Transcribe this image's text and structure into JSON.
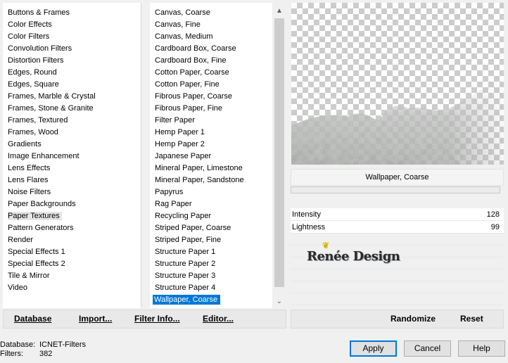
{
  "categories": {
    "items": [
      {
        "label": "Buttons & Frames"
      },
      {
        "label": "Color Effects"
      },
      {
        "label": "Color Filters"
      },
      {
        "label": "Convolution Filters"
      },
      {
        "label": "Distortion Filters"
      },
      {
        "label": "Edges, Round"
      },
      {
        "label": "Edges, Square"
      },
      {
        "label": "Frames, Marble & Crystal"
      },
      {
        "label": "Frames, Stone & Granite"
      },
      {
        "label": "Frames, Textured"
      },
      {
        "label": "Frames, Wood"
      },
      {
        "label": "Gradients"
      },
      {
        "label": "Image Enhancement"
      },
      {
        "label": "Lens Effects"
      },
      {
        "label": "Lens Flares"
      },
      {
        "label": "Noise Filters"
      },
      {
        "label": "Paper Backgrounds"
      },
      {
        "label": "Paper Textures"
      },
      {
        "label": "Pattern Generators"
      },
      {
        "label": "Render"
      },
      {
        "label": "Special Effects 1"
      },
      {
        "label": "Special Effects 2"
      },
      {
        "label": "Tile & Mirror"
      },
      {
        "label": "Video"
      }
    ],
    "selected_index": 17
  },
  "filters": {
    "items": [
      {
        "label": "Canvas, Coarse"
      },
      {
        "label": "Canvas, Fine"
      },
      {
        "label": "Canvas, Medium"
      },
      {
        "label": "Cardboard Box, Coarse"
      },
      {
        "label": "Cardboard Box, Fine"
      },
      {
        "label": "Cotton Paper, Coarse"
      },
      {
        "label": "Cotton Paper, Fine"
      },
      {
        "label": "Fibrous Paper, Coarse"
      },
      {
        "label": "Fibrous Paper, Fine"
      },
      {
        "label": "Filter Paper"
      },
      {
        "label": "Hemp Paper 1"
      },
      {
        "label": "Hemp Paper 2"
      },
      {
        "label": "Japanese Paper"
      },
      {
        "label": "Mineral Paper, Limestone"
      },
      {
        "label": "Mineral Paper, Sandstone"
      },
      {
        "label": "Papyrus"
      },
      {
        "label": "Rag Paper"
      },
      {
        "label": "Recycling Paper"
      },
      {
        "label": "Striped Paper, Coarse"
      },
      {
        "label": "Striped Paper, Fine"
      },
      {
        "label": "Structure Paper 1"
      },
      {
        "label": "Structure Paper 2"
      },
      {
        "label": "Structure Paper 3"
      },
      {
        "label": "Structure Paper 4"
      },
      {
        "label": "Wallpaper, Coarse"
      }
    ],
    "selected_index": 24
  },
  "scroll": {
    "up_icon": "▲",
    "down_icon": "⌄"
  },
  "selected_filter_name": "Wallpaper, Coarse",
  "params": [
    {
      "label": "Intensity",
      "value": "128"
    },
    {
      "label": "Lightness",
      "value": "99"
    }
  ],
  "watermark": {
    "text": "Renée Design"
  },
  "left_toolbar": {
    "database": "Database",
    "import": "Import...",
    "filter_info": "Filter Info...",
    "editor": "Editor..."
  },
  "right_toolbar": {
    "randomize": "Randomize",
    "reset": "Reset"
  },
  "info": {
    "database_label": "Database:",
    "database_value": "ICNET-Filters",
    "filters_label": "Filters:",
    "filters_value": "382"
  },
  "buttons": {
    "apply": "Apply",
    "cancel": "Cancel",
    "help": "Help"
  },
  "colors": {
    "selection": "#0078d7",
    "apply_border": "#0078d7"
  }
}
